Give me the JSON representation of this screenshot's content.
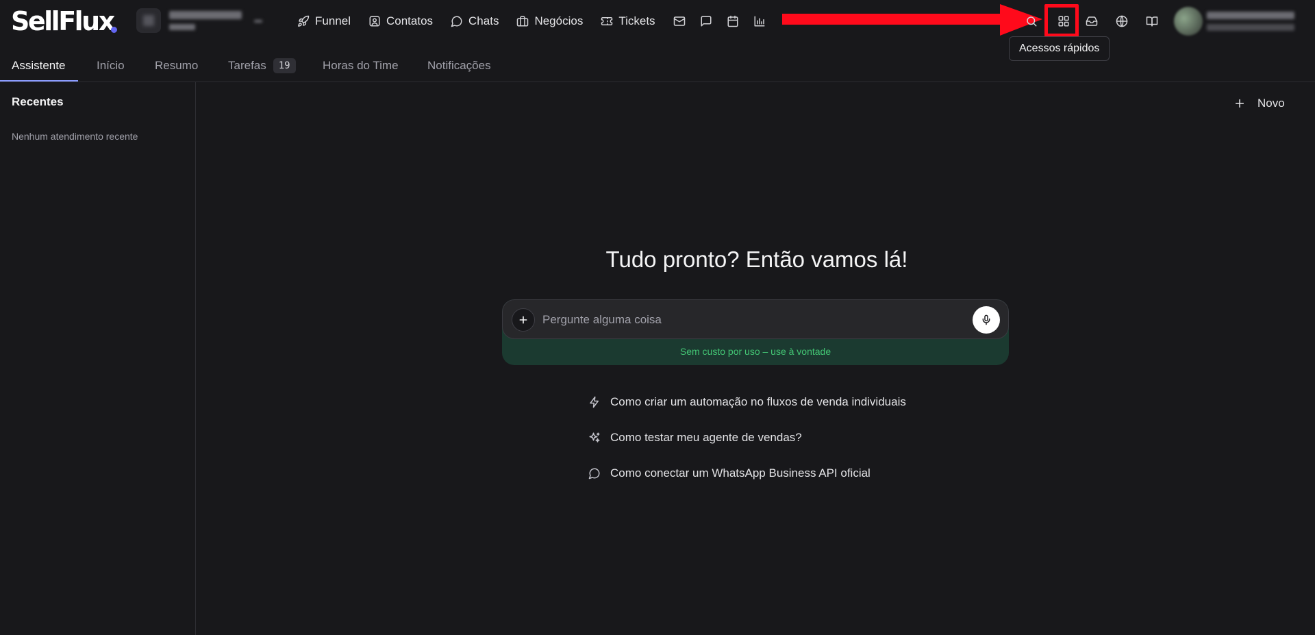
{
  "brand": {
    "name": "SellFlux",
    "accent": "#6366f1"
  },
  "nav": {
    "items": [
      {
        "label": "Funnel",
        "icon": "rocket-icon"
      },
      {
        "label": "Contatos",
        "icon": "contact-card-icon"
      },
      {
        "label": "Chats",
        "icon": "chat-bubble-icon"
      },
      {
        "label": "Negócios",
        "icon": "briefcase-icon"
      },
      {
        "label": "Tickets",
        "icon": "ticket-icon"
      }
    ],
    "icon_buttons": [
      "mail-icon",
      "message-square-icon",
      "calendar-icon",
      "bar-chart-icon"
    ]
  },
  "header_right": {
    "icons": [
      "search-icon",
      "grid-icon",
      "inbox-icon",
      "globe-icon",
      "book-icon"
    ],
    "tooltip": "Acessos rápidos",
    "highlight_color": "#ff0a1b"
  },
  "tabs": [
    {
      "label": "Assistente",
      "active": true
    },
    {
      "label": "Início"
    },
    {
      "label": "Resumo"
    },
    {
      "label": "Tarefas",
      "badge": "19"
    },
    {
      "label": "Horas do Time"
    },
    {
      "label": "Notificações"
    }
  ],
  "sidebar": {
    "title": "Recentes",
    "empty_text": "Nenhum atendimento recente"
  },
  "main": {
    "new_button": "Novo",
    "hero": "Tudo pronto? Então vamos lá!",
    "input_placeholder": "Pergunte alguma coisa",
    "note": "Sem custo por uso – use à vontade",
    "suggestions": [
      {
        "text": "Como criar um automação no fluxos de venda individuais",
        "icon": "lightning-icon"
      },
      {
        "text": "Como testar meu agente de vendas?",
        "icon": "sparkles-icon"
      },
      {
        "text": "Como conectar um WhatsApp Business API oficial",
        "icon": "chat-bubble-icon"
      }
    ]
  }
}
